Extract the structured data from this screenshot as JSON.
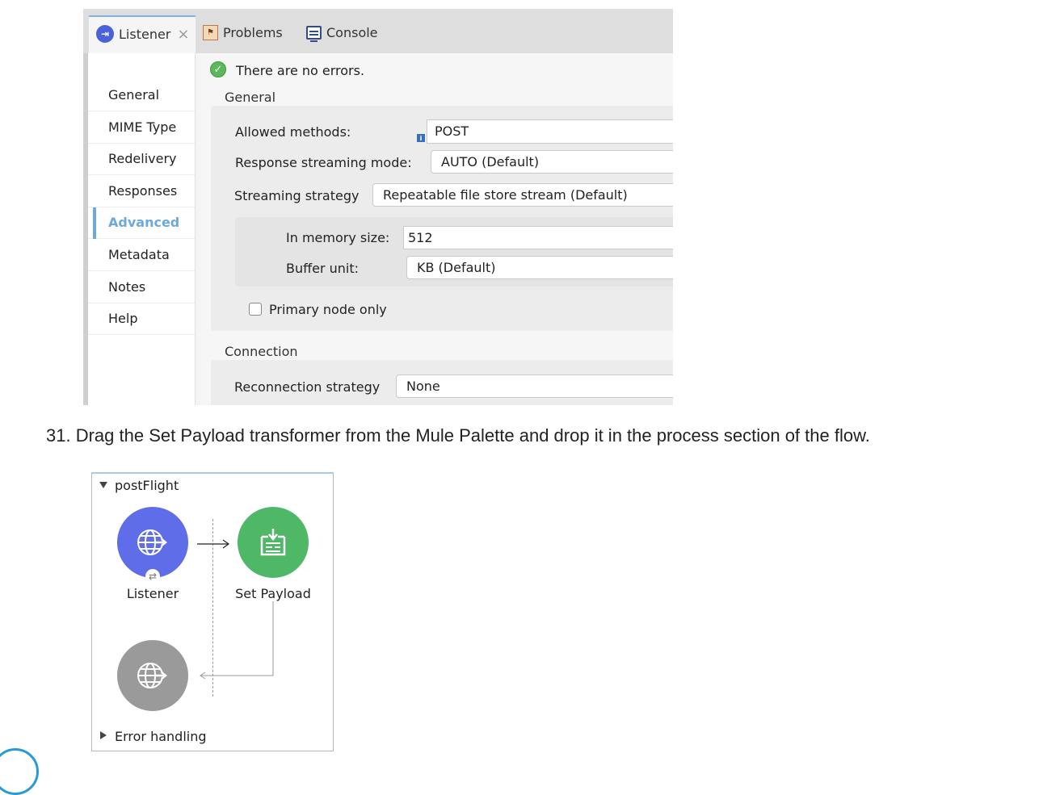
{
  "properties": {
    "tabs": [
      {
        "label": "Listener",
        "icon": "listener-icon",
        "active": true
      },
      {
        "label": "Problems",
        "icon": "problems-icon"
      },
      {
        "label": "Console",
        "icon": "console-icon"
      }
    ],
    "status": "There are no errors.",
    "nav": [
      "General",
      "MIME Type",
      "Redelivery",
      "Responses",
      "Advanced",
      "Metadata",
      "Notes",
      "Help"
    ],
    "nav_active": "Advanced",
    "general": {
      "title": "General",
      "allowed_methods_label": "Allowed methods:",
      "allowed_methods_value": "POST",
      "response_streaming_label": "Response streaming mode:",
      "response_streaming_value": "AUTO (Default)",
      "streaming_strategy_label": "Streaming strategy",
      "streaming_strategy_value": "Repeatable file store stream (Default)",
      "in_memory_size_label": "In memory size:",
      "in_memory_size_value": "512",
      "buffer_unit_label": "Buffer unit:",
      "buffer_unit_value": "KB (Default)",
      "primary_node_label": "Primary node only",
      "primary_node_checked": false
    },
    "connection": {
      "title": "Connection",
      "reconnection_label": "Reconnection strategy",
      "reconnection_value": "None"
    }
  },
  "instruction": "31. Drag the Set Payload transformer from the Mule Palette and drop it in the process section of the flow.",
  "flow": {
    "name": "postFlight",
    "source_label": "Listener",
    "processor_label": "Set Payload",
    "error_handling_label": "Error handling",
    "colors": {
      "listener": "#5f6ee8",
      "set_payload": "#4fb866",
      "response": "#9a9a9a"
    }
  }
}
